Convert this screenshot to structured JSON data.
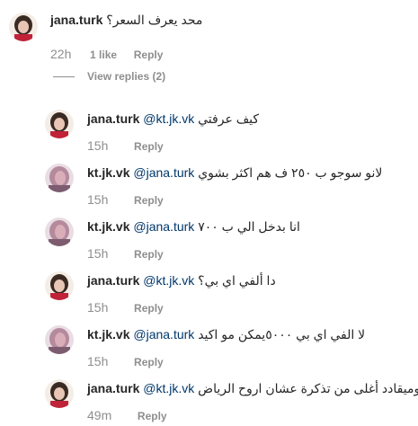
{
  "top_comment": {
    "username": "jana.turk",
    "text": "محد يعرف السعر؟",
    "time": "22h",
    "likes": "1 like",
    "reply": "Reply",
    "view_replies": "View replies (2)"
  },
  "replies": [
    {
      "username": "jana.turk",
      "mention": "@kt.jk.vk",
      "text": "كيف عرفتي",
      "time": "15h",
      "reply": "Reply",
      "avatar": "jana"
    },
    {
      "username": "kt.jk.vk",
      "mention": "@jana.turk",
      "text": "لانو سوجو ب ٢٥٠ ف هم اكثر بشوي",
      "time": "15h",
      "reply": "Reply",
      "avatar": "kt"
    },
    {
      "username": "kt.jk.vk",
      "mention": "@jana.turk",
      "text": "انا بدخل الي ب ٧٠٠",
      "time": "15h",
      "reply": "Reply",
      "avatar": "kt"
    },
    {
      "username": "jana.turk",
      "mention": "@kt.jk.vk",
      "text": "دا ألفي اي بي؟",
      "time": "15h",
      "reply": "Reply",
      "avatar": "jana"
    },
    {
      "username": "kt.jk.vk",
      "mention": "@jana.turk",
      "text": "لا الفي اي بي ٥٠٠٠يمكن مو اكيد",
      "time": "15h",
      "reply": "Reply",
      "avatar": "kt"
    },
    {
      "username": "jana.turk",
      "mention": "@kt.jk.vk",
      "text": "اوميقادد أغلى من تذكرة عشان اروح الرياض",
      "time": "49m",
      "reply": "Reply",
      "avatar": "jana"
    }
  ]
}
